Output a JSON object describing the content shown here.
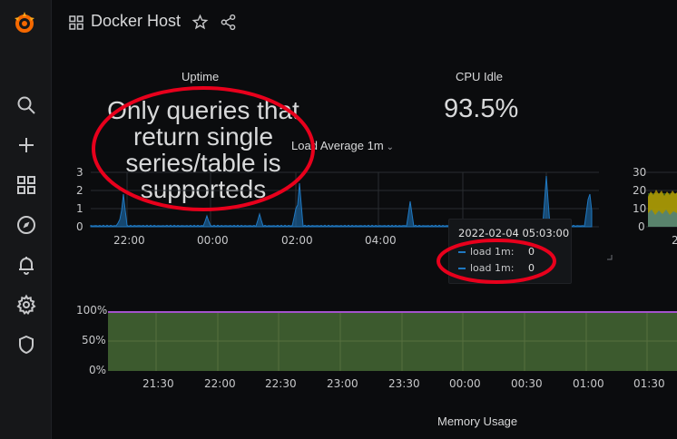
{
  "header": {
    "title": "Docker Host"
  },
  "sidebar": {
    "items": [
      {
        "icon": "search-icon"
      },
      {
        "icon": "plus-icon"
      },
      {
        "icon": "dashboards-icon"
      },
      {
        "icon": "explore-icon"
      },
      {
        "icon": "bell-icon"
      },
      {
        "icon": "gear-icon"
      },
      {
        "icon": "shield-icon"
      }
    ]
  },
  "panels": {
    "uptime": {
      "title": "Uptime",
      "error": "Only queries that\nreturn single\nseries/table is\nsupporteds"
    },
    "cpu_idle": {
      "title": "CPU Idle",
      "value": "93.5%"
    },
    "load_average": {
      "title": "Load Average 1m",
      "y_ticks": [
        "3",
        "2",
        "1",
        "0"
      ],
      "x_ticks": [
        "22:00",
        "00:00",
        "02:00",
        "04:00"
      ]
    },
    "right_mini": {
      "y_ticks": [
        "30",
        "20",
        "10",
        "0"
      ],
      "x_tick": "2"
    },
    "percent_chart": {
      "y_ticks": [
        "100%",
        "50%",
        "0%"
      ],
      "x_ticks": [
        "21:30",
        "22:00",
        "22:30",
        "23:00",
        "23:30",
        "00:00",
        "00:30",
        "01:00",
        "01:30"
      ]
    },
    "memory_usage": {
      "title": "Memory Usage"
    }
  },
  "tooltip": {
    "time": "2022-02-04 05:03:00",
    "rows": [
      {
        "label": "load 1m:",
        "value": "0"
      },
      {
        "label": "load 1m:",
        "value": "0"
      }
    ]
  },
  "colors": {
    "series_blue": "#1f78c1",
    "fill_green": "#3c5a2e",
    "line_purple": "#a352cc",
    "annotation_red": "#e8001c"
  }
}
